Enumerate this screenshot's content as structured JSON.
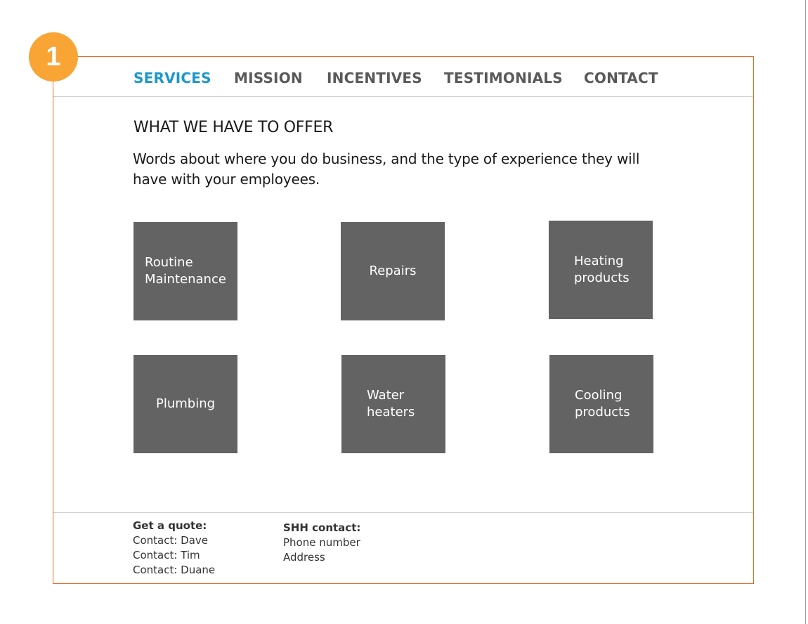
{
  "step_badge": "1",
  "nav": {
    "items": [
      {
        "label": "SERVICES",
        "active": true
      },
      {
        "label": "MISSION",
        "active": false
      },
      {
        "label": "INCENTIVES",
        "active": false
      },
      {
        "label": "TESTIMONIALS",
        "active": false
      },
      {
        "label": "CONTACT",
        "active": false
      }
    ]
  },
  "main": {
    "heading": "WHAT WE HAVE TO OFFER",
    "intro": "Words about where you do business, and the type of experience they will have with your employees."
  },
  "services": [
    {
      "line1": "Routine",
      "line2": "Maintenance"
    },
    {
      "line1": "Repairs",
      "line2": ""
    },
    {
      "line1": "Heating",
      "line2": "products"
    },
    {
      "line1": "Plumbing",
      "line2": ""
    },
    {
      "line1": "Water",
      "line2": "heaters"
    },
    {
      "line1": "Cooling",
      "line2": "products"
    }
  ],
  "footer": {
    "quote": {
      "title": "Get a quote:",
      "lines": [
        "Contact: Dave",
        "Contact: Tim",
        "Contact: Duane"
      ]
    },
    "shh": {
      "title": "SHH contact:",
      "lines": [
        "Phone number",
        "Address"
      ]
    }
  },
  "colors": {
    "accent": "#1b98cd",
    "frame": "#e8692c",
    "badge": "#f8a536",
    "tile": "#636363",
    "nav_text": "#595959"
  }
}
